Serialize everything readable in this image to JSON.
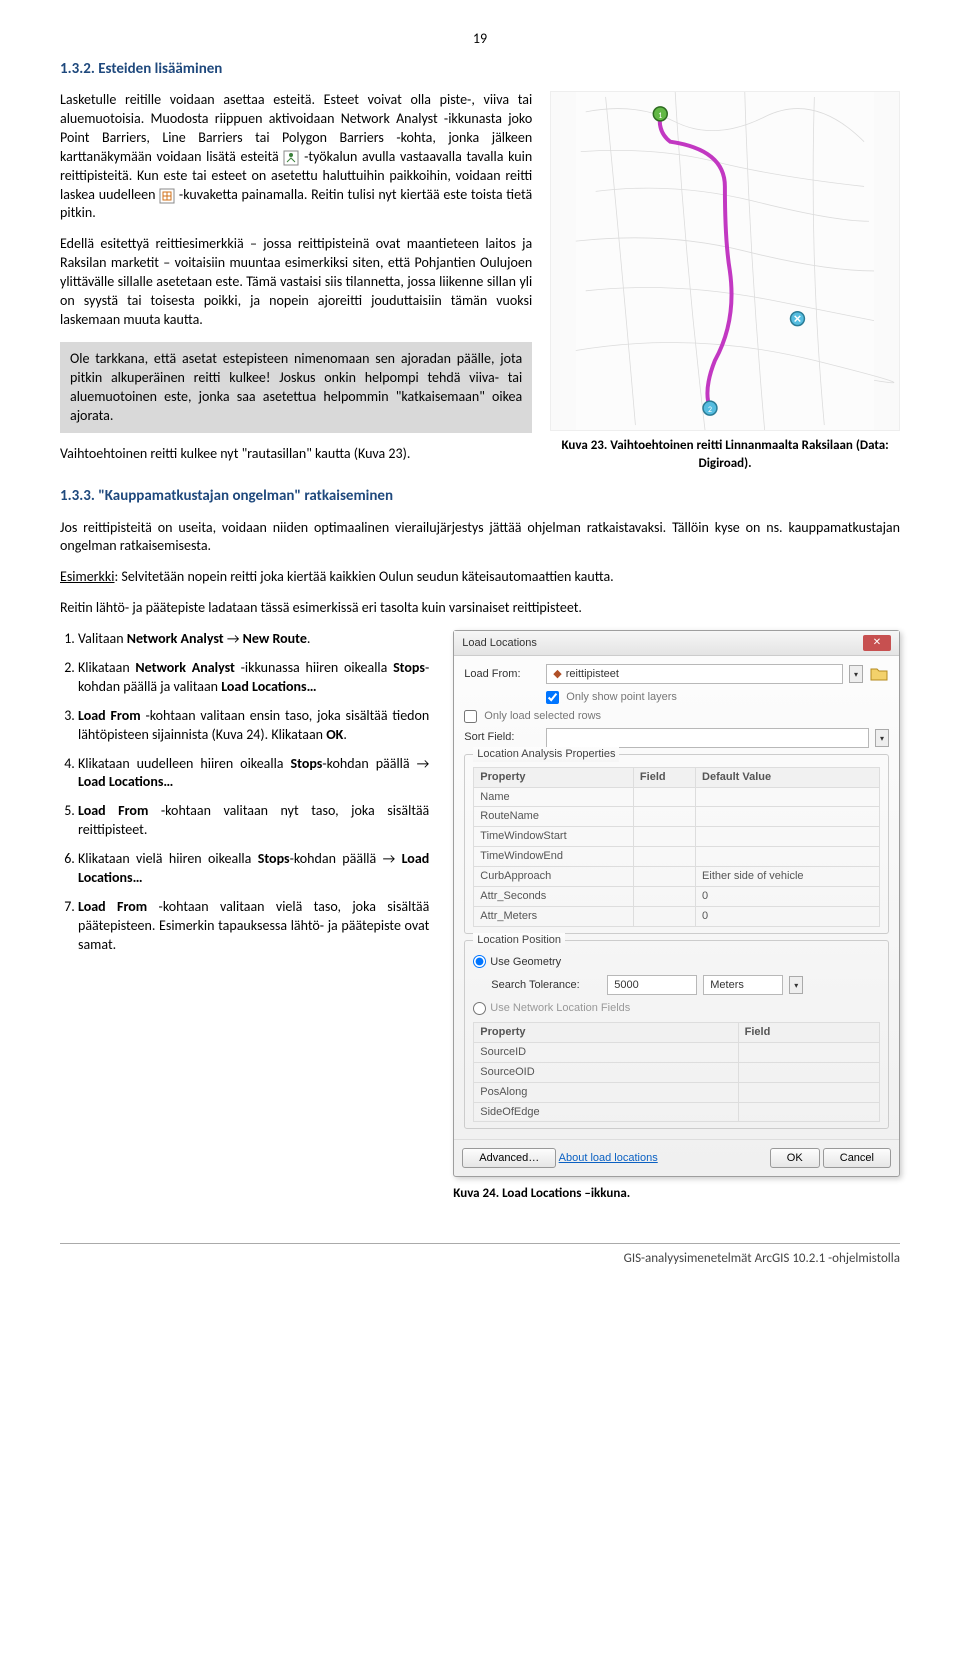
{
  "page_number": "19",
  "s1": {
    "heading": "1.3.2. Esteiden lisääminen",
    "p1": "Lasketulle reitille voidaan asettaa esteitä. Esteet voivat olla piste-, viiva tai aluemuotoisia. Muodosta riippuen aktivoidaan Network Analyst -ikkunasta joko Point Barriers, Line Barriers tai Polygon Barriers -kohta, jonka jälkeen",
    "p1b": "karttanäkymään voidaan lisätä esteitä ",
    "p1c": " -työkalun avulla vastaavalla tavalla kuin reittipisteitä. Kun este tai esteet on asetettu haluttuihin paikkoihin, voidaan reitti laskea",
    "p2a": "uudelleen ",
    "p2b": " -kuvaketta painamalla. Reitin tulisi nyt kiertää este toista tietä pitkin.",
    "p3": "Edellä esitettyä reittiesimerkkiä – jossa reittipisteinä ovat maantieteen laitos ja Raksilan marketit – voitaisiin muuntaa esimerkiksi siten, että Pohjantien Oulujoen ylittävälle sillalle asetetaan este. Tämä vastaisi siis tilannetta, jossa liikenne sillan yli on syystä tai toisesta poikki, ja nopein ajoreitti jouduttaisiin tämän vuoksi laskemaan muuta kautta.",
    "callout": "Ole tarkkana, että asetat estepisteen nimenomaan sen ajoradan päälle, jota pitkin alkuperäinen reitti kulkee! Joskus onkin helpompi tehdä viiva- tai aluemuotoinen este, jonka saa asetettua helpommin \"katkaisemaan\" oikea ajorata.",
    "p4": "Vaihtoehtoinen reitti kulkee nyt \"rautasillan\" kautta (Kuva 23).",
    "caption23": "Kuva 23. Vaihtoehtoinen reitti Linnanmaalta Raksilaan (Data: Digiroad)."
  },
  "s2": {
    "heading": "1.3.3. \"Kauppamatkustajan ongelman\" ratkaiseminen",
    "p1": "Jos reittipisteitä on useita, voidaan niiden optimaalinen vierailujärjestys jättää ohjelman ratkaistavaksi. Tällöin kyse on ns. kauppamatkustajan ongelman ratkaisemisesta.",
    "p2a": "Esimerkki",
    "p2b": ": Selvitetään nopein reitti joka kiertää kaikkien Oulun seudun käteisautomaattien kautta.",
    "p3": "Reitin lähtö- ja päätepiste ladataan tässä esimerkissä eri tasolta kuin varsinaiset reittipisteet.",
    "li1a": "Valitaan ",
    "li1b": "Network Analyst",
    "li1c": " → ",
    "li1d": "New Route",
    "li1e": ".",
    "li2a": "Klikataan ",
    "li2b": "Network Analyst",
    "li2c": " -ikkunassa hiiren oikealla ",
    "li2d": "Stops",
    "li2e": "-kohdan päällä ja valitaan ",
    "li2f": "Load Locations…",
    "li3a": "Load From",
    "li3b": " -kohtaan valitaan ensin taso, joka sisältää tiedon lähtöpisteen sijainnista (Kuva 24). Klikataan ",
    "li3c": "OK",
    "li3d": ".",
    "li4a": "Klikataan uudelleen hiiren oikealla ",
    "li4b": "Stops",
    "li4c": "-kohdan päällä → ",
    "li4d": "Load Locations…",
    "li5a": "Load From",
    "li5b": " -kohtaan valitaan nyt taso, joka sisältää reittipisteet.",
    "li6a": "Klikataan vielä hiiren oikealla ",
    "li6b": "Stops",
    "li6c": "-kohdan päällä → ",
    "li6d": "Load Locations…",
    "li7a": "Load From",
    "li7b": " -kohtaan valitaan vielä taso, joka sisältää päätepisteen. Esimerkin tapauksessa lähtö- ja päätepiste ovat samat.",
    "caption24": "Kuva 24. Load Locations –ikkuna."
  },
  "dlg": {
    "title": "Load Locations",
    "loadfrom_label": "Load From:",
    "loadfrom_value": "reittipisteet",
    "only_point": "Only show point layers",
    "only_selected": "Only load selected rows",
    "sort_label": "Sort Field:",
    "group1": "Location Analysis Properties",
    "col_prop": "Property",
    "col_field": "Field",
    "col_default": "Default Value",
    "rows1": [
      "Name",
      "RouteName",
      "TimeWindowStart",
      "TimeWindowEnd",
      "CurbApproach",
      "Attr_Seconds",
      "Attr_Meters"
    ],
    "def_curb": "Either side of vehicle",
    "def_zero": "0",
    "group2": "Location Position",
    "use_geom": "Use Geometry",
    "search_tol": "Search Tolerance:",
    "tol_val": "5000",
    "tol_unit": "Meters",
    "use_net": "Use Network Location Fields",
    "rows2": [
      "SourceID",
      "SourceOID",
      "PosAlong",
      "SideOfEdge"
    ],
    "advanced": "Advanced…",
    "about": "About load locations",
    "ok": "OK",
    "cancel": "Cancel"
  },
  "footer": "GIS-analyysimenetelmät ArcGIS 10.2.1 -ohjelmistolla"
}
